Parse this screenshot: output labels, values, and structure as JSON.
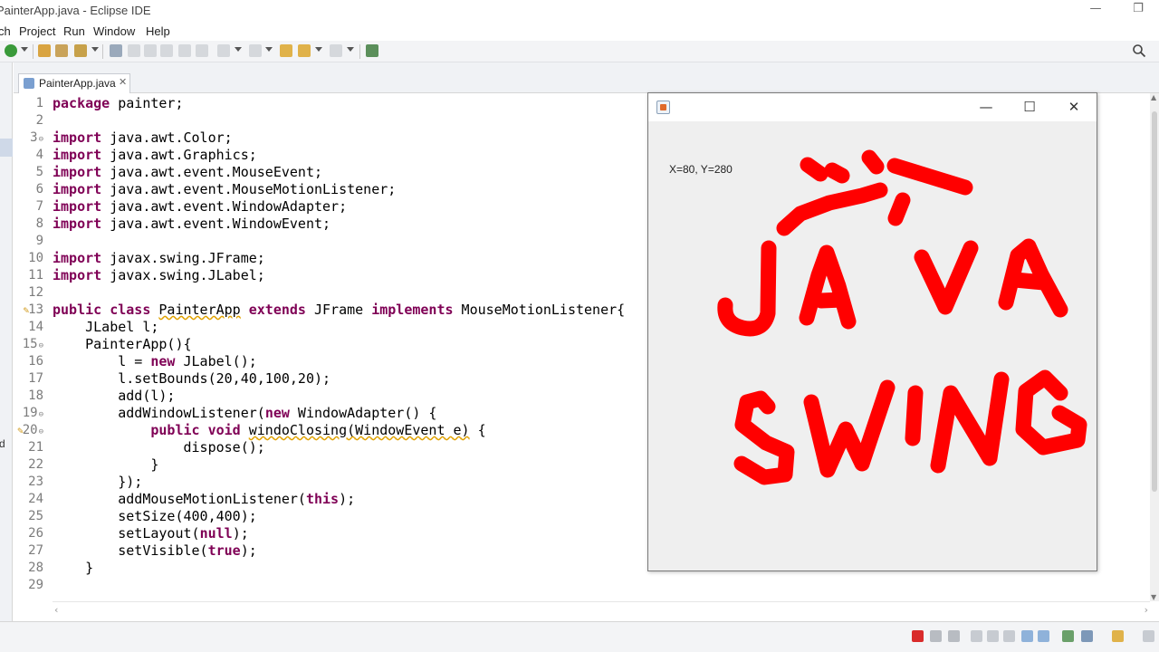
{
  "window": {
    "title": "PainterApp.java - Eclipse IDE",
    "visible_title": "PainterApp.java - Eclipse IDE"
  },
  "menu": [
    "ch",
    "Project",
    "Run",
    "Window",
    "Help"
  ],
  "left_strip_text": "d",
  "editor_tab": {
    "label": "PainterApp.java",
    "close": "✕"
  },
  "code_lines": [
    {
      "n": "1",
      "text": "package painter;"
    },
    {
      "n": "2",
      "text": ""
    },
    {
      "n": "3",
      "text": "import java.awt.Color;"
    },
    {
      "n": "4",
      "text": "import java.awt.Graphics;"
    },
    {
      "n": "5",
      "text": "import java.awt.event.MouseEvent;"
    },
    {
      "n": "6",
      "text": "import java.awt.event.MouseMotionListener;"
    },
    {
      "n": "7",
      "text": "import java.awt.event.WindowAdapter;"
    },
    {
      "n": "8",
      "text": "import java.awt.event.WindowEvent;"
    },
    {
      "n": "9",
      "text": ""
    },
    {
      "n": "10",
      "text": "import javax.swing.JFrame;"
    },
    {
      "n": "11",
      "text": "import javax.swing.JLabel;"
    },
    {
      "n": "12",
      "text": ""
    },
    {
      "n": "13",
      "text": "public class PainterApp extends JFrame implements MouseMotionListener{"
    },
    {
      "n": "14",
      "text": "    JLabel l;"
    },
    {
      "n": "15",
      "text": "    PainterApp(){"
    },
    {
      "n": "16",
      "text": "        l = new JLabel();"
    },
    {
      "n": "17",
      "text": "        l.setBounds(20,40,100,20);"
    },
    {
      "n": "18",
      "text": "        add(l);"
    },
    {
      "n": "19",
      "text": "        addWindowListener(new WindowAdapter() {"
    },
    {
      "n": "20",
      "text": "            public void windoClosing(WindowEvent e) {"
    },
    {
      "n": "21",
      "text": "                dispose();"
    },
    {
      "n": "22",
      "text": "            }"
    },
    {
      "n": "23",
      "text": "        });"
    },
    {
      "n": "24",
      "text": "        addMouseMotionListener(this);"
    },
    {
      "n": "25",
      "text": "        setSize(400,400);"
    },
    {
      "n": "26",
      "text": "        setLayout(null);"
    },
    {
      "n": "27",
      "text": "        setVisible(true);"
    },
    {
      "n": "28",
      "text": "    }"
    },
    {
      "n": "29",
      "text": ""
    }
  ],
  "swing_window": {
    "title": "",
    "label_text": "X=80, Y=280",
    "drawn_text": "JAVA SWING",
    "paint_color": "#ff0000",
    "buttons": {
      "minimize": "—",
      "maximize": "☐",
      "close": "✕"
    }
  },
  "colors": {
    "keyword": "#7f0055",
    "line_number": "#7c7c7c",
    "warning_underline": "#e0a100"
  }
}
